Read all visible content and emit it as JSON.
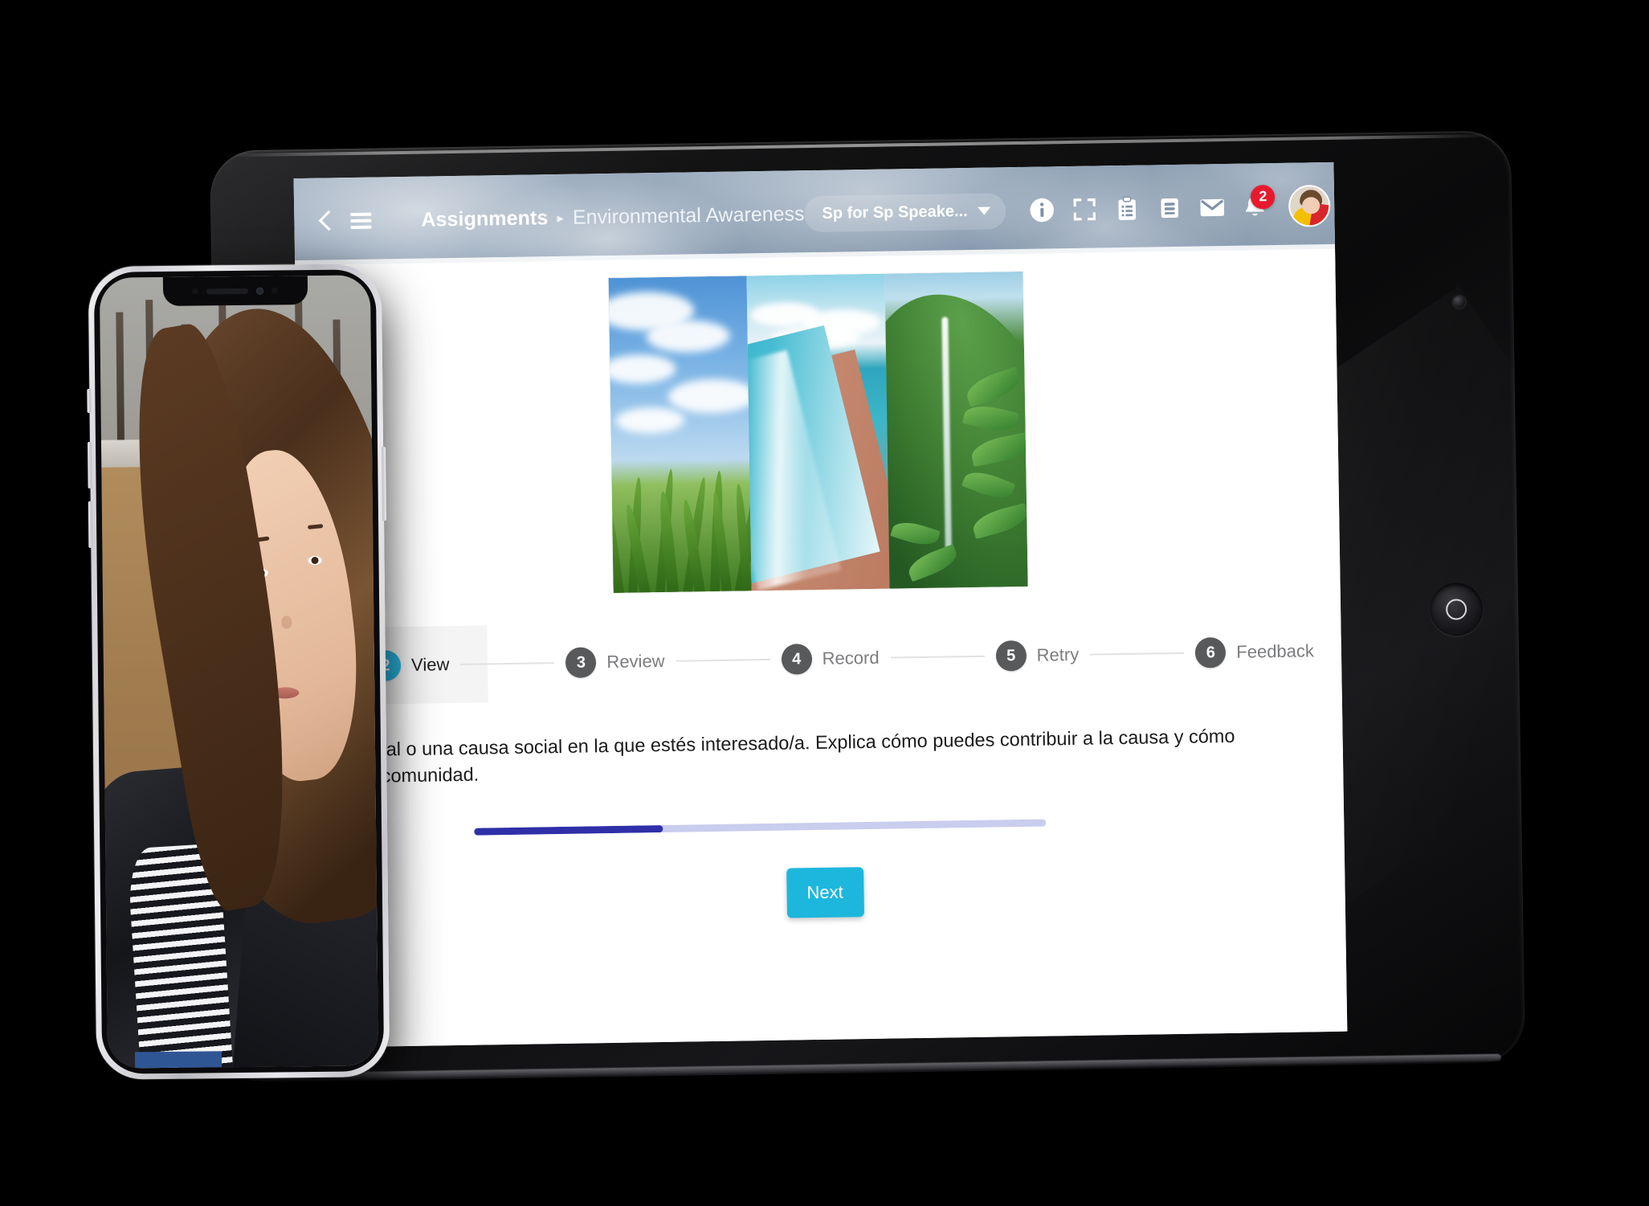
{
  "app": {
    "header": {
      "back_icon": "chevron-left-icon",
      "menu_icon": "hamburger-menu-icon",
      "breadcrumb_root": "Assignments",
      "breadcrumb_separator": "▸",
      "breadcrumb_current": "Environmental Awareness",
      "course_selector": {
        "label": "Sp for Sp Speake...",
        "caret_icon": "chevron-down-icon"
      },
      "icons": [
        {
          "name": "info-icon",
          "title": "Info"
        },
        {
          "name": "fullscreen-icon",
          "title": "Fullscreen"
        },
        {
          "name": "clipboard-icon",
          "title": "Assignments"
        },
        {
          "name": "book-icon",
          "title": "Resources"
        },
        {
          "name": "envelope-icon",
          "title": "Messages"
        },
        {
          "name": "bell-icon",
          "title": "Notifications"
        }
      ],
      "notification_count": "2",
      "avatar_name": "user-avatar"
    },
    "media": {
      "collage_alt": "Environmental nature collage",
      "panes": [
        {
          "name": "crop-field-sky",
          "caption": "Green crop field under cloudy blue sky"
        },
        {
          "name": "beach-shoreline",
          "caption": "Aerial view of turquoise ocean meeting sandy beach"
        },
        {
          "name": "jungle-waterfall",
          "caption": "Tropical waterfall on a lush green hillside"
        }
      ]
    },
    "steps": [
      {
        "number": "2",
        "label": "View",
        "active": true
      },
      {
        "number": "3",
        "label": "Review",
        "active": false
      },
      {
        "number": "4",
        "label": "Record",
        "active": false
      },
      {
        "number": "5",
        "label": "Retry",
        "active": false
      },
      {
        "number": "6",
        "label": "Feedback",
        "active": false
      }
    ],
    "prompt": {
      "line1": "nbiental o una causa social en la que estés interesado/a. Explica cómo puedes contribuir a la causa y cómo",
      "line2": "de la comunidad."
    },
    "progress": {
      "percent": "33"
    },
    "next_button": "Next",
    "colors": {
      "accent_cyan": "#1db7dd",
      "step_active": "#29b6e0",
      "step_inactive": "#58595b",
      "badge_red": "#e8192c",
      "progress_fill": "#2f2fa8",
      "progress_track": "#c9cdee"
    }
  },
  "devices": {
    "tablet": {
      "name": "tablet-device",
      "home_button": "home-button"
    },
    "phone": {
      "name": "phone-device",
      "screen_content": "selfie-video-of-student-outdoors",
      "notch": "front-camera-notch"
    }
  }
}
